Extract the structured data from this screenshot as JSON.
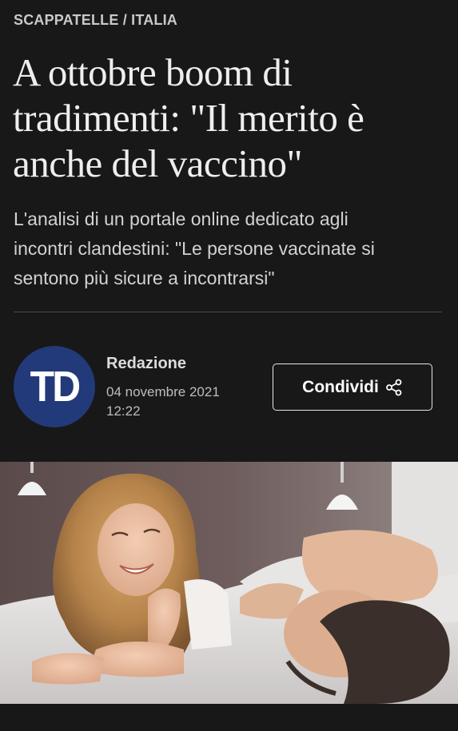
{
  "article": {
    "category": "SCAPPATELLE / ITALIA",
    "headline": {
      "line1": "A ottobre boom di",
      "line2": "tradimenti: \"Il merito è",
      "line3": "anche del vaccino\""
    },
    "subtitle": {
      "line1": "L'analisi di un portale online dedicato agli",
      "line2": "incontri clandestini: \"Le persone vaccinate si",
      "line3": "sentono più sicure a incontrarsi\""
    }
  },
  "author": {
    "logo_text": "TD",
    "name": "Redazione",
    "date": "04 novembre 2021",
    "time": "12:22"
  },
  "share": {
    "label": "Condividi",
    "icon": "share-icon"
  },
  "hero_image": {
    "icon": "photo-couple-in-bed"
  },
  "colors": {
    "background": "#181818",
    "logo_background": "#223a7a",
    "text": "#eeeeee"
  }
}
